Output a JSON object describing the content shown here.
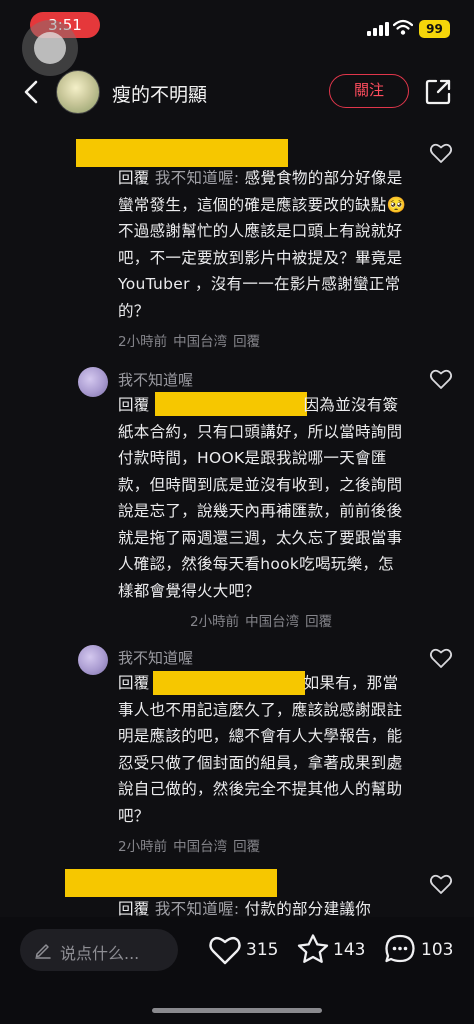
{
  "status_bar": {
    "time": "3:51",
    "battery": "99"
  },
  "header": {
    "user_name": "瘦的不明顯",
    "follow_label": "關注"
  },
  "comments": [
    {
      "reply_word": "回覆",
      "reply_target": "我不知道喔:",
      "text": "感覺食物的部分好像是蠻常發生，這個的確是應該要改的缺點🥺 不過感謝幫忙的人應該是口頭上有說就好吧，不一定要放到影片中被提及？畢竟是YouTuber ，沒有一一在影片感謝蠻正常的？",
      "time": "2小時前",
      "location": "中国台湾",
      "reply_action": "回覆"
    },
    {
      "name": "我不知道喔",
      "reply_word": "回覆",
      "text": "因為並沒有簽紙本合約，只有口頭講好，所以當時詢問付款時間，HOOK是跟我說哪一天會匯款，但時間到底是並沒有收到，之後詢問說是忘了，說幾天內再補匯款，前前後後就是拖了兩週還三週，太久忘了要跟當事人確認，然後每天看hook吃喝玩樂，怎樣都會覺得火大吧？",
      "time": "2小時前",
      "location": "中国台湾",
      "reply_action": "回覆"
    },
    {
      "name": "我不知道喔",
      "reply_word": "回覆",
      "text": "如果有，那當事人也不用記這麼久了，應該說感謝跟註明是應該的吧，總不會有人大學報告，能忍受只做了個封面的組員，拿著成果到處說自己做的，然後完全不提其他人的幫助吧？",
      "time": "2小時前",
      "location": "中国台湾",
      "reply_action": "回覆"
    },
    {
      "reply_word": "回覆",
      "reply_target": "我不知道喔:",
      "text": "付款的部分建議你"
    }
  ],
  "bottom_bar": {
    "placeholder": "说点什么...",
    "likes": "315",
    "favorites": "143",
    "comments": "103"
  }
}
